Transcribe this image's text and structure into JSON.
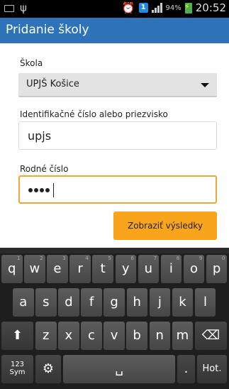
{
  "status_bar": {
    "badge": "1",
    "battery_pct": "94%",
    "time": "20:52"
  },
  "action_bar": {
    "title": "Pridanie školy"
  },
  "form": {
    "school_label": "Škola",
    "school_value": "UPJŠ Košice",
    "id_label": "Identifikačné číslo alebo priezvisko",
    "id_value": "upjs",
    "birth_label": "Rodné číslo",
    "birth_masked_length": 4,
    "show_button": "Zobraziť výsledky"
  },
  "keyboard": {
    "row1": [
      {
        "k": "q",
        "s": "1"
      },
      {
        "k": "w",
        "s": "2"
      },
      {
        "k": "e",
        "s": "3"
      },
      {
        "k": "r",
        "s": "4"
      },
      {
        "k": "t",
        "s": "5"
      },
      {
        "k": "y",
        "s": "6"
      },
      {
        "k": "u",
        "s": "7"
      },
      {
        "k": "i",
        "s": "8"
      },
      {
        "k": "o",
        "s": "9"
      },
      {
        "k": "p",
        "s": "0"
      }
    ],
    "row2": [
      "a",
      "s",
      "d",
      "f",
      "g",
      "h",
      "j",
      "k",
      "l"
    ],
    "row3": [
      "z",
      "x",
      "c",
      "v",
      "b",
      "n",
      "m"
    ],
    "sym_top": "123",
    "sym_bottom": "Sym",
    "period": ".",
    "hot": "Hot."
  }
}
